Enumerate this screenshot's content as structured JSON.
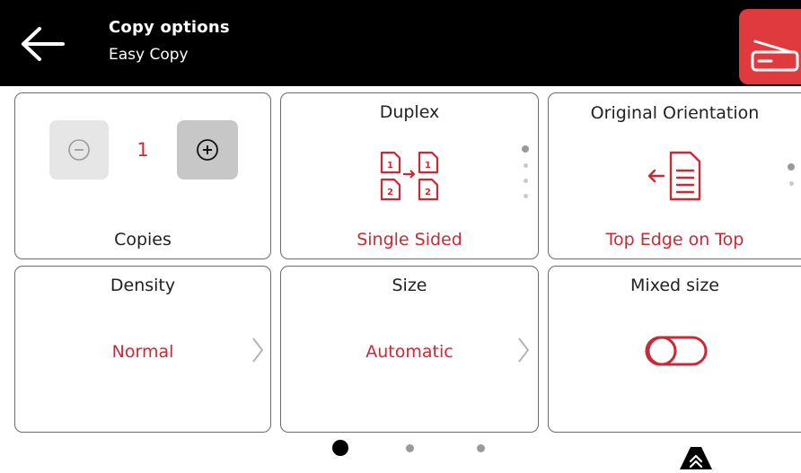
{
  "header": {
    "title": "Copy options",
    "subtitle": "Easy Copy",
    "back_icon": "arrow-left-icon",
    "scan_icon": "scanner-icon",
    "accent": "#e03a3f"
  },
  "cards": {
    "copies": {
      "label": "Copies",
      "value": "1",
      "minus_icon": "minus-circle-icon",
      "plus_icon": "plus-circle-icon"
    },
    "duplex": {
      "title": "Duplex",
      "value": "Single Sided",
      "icon": "duplex-pages-icon",
      "dots": 4,
      "active_dot": 1
    },
    "orientation": {
      "title": "Original Orientation",
      "value": "Top Edge on Top",
      "icon": "document-arrow-left-icon",
      "dots": 2,
      "active_dot": 1
    },
    "density": {
      "title": "Density",
      "value": "Normal"
    },
    "size": {
      "title": "Size",
      "value": "Automatic"
    },
    "mixed_size": {
      "title": "Mixed size",
      "toggle": "off",
      "icon": "toggle-off-icon"
    }
  },
  "pager": {
    "pages": 3,
    "current": 1
  },
  "scroll_up_icon": "double-chevron-up-icon",
  "colors": {
    "value_red": "#c92a36",
    "bar": "#000000"
  }
}
